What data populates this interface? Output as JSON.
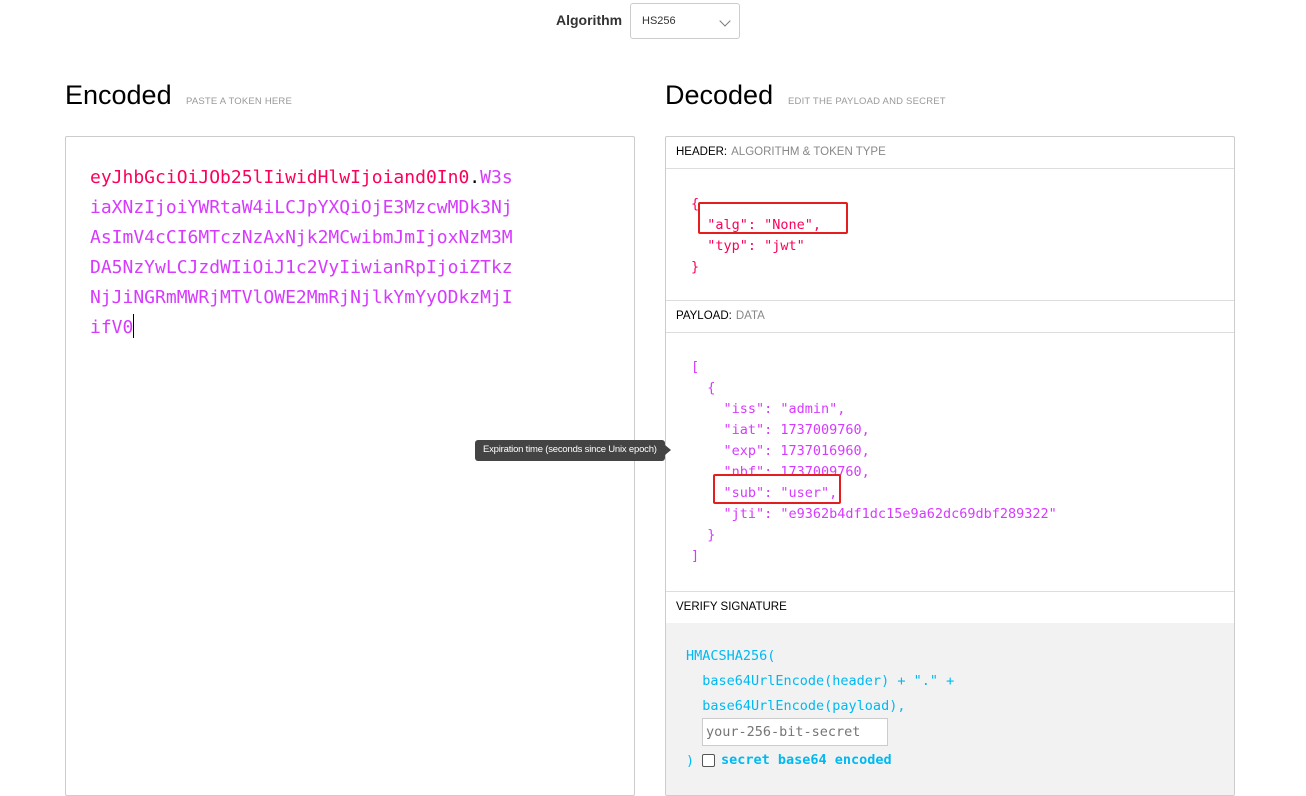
{
  "algorithm": {
    "label": "Algorithm",
    "selected": "HS256"
  },
  "encoded": {
    "title": "Encoded",
    "subtitle": "PASTE A TOKEN HERE",
    "header_part": "eyJhbGciOiJOb25lIiwidHlwIjoiand0In0",
    "dot": ".",
    "payload_lines": [
      "W3s",
      "iaXNzIjoiYWRtaW4iLCJpYXQiOjE3MzcwMDk3Nj",
      "AsImV4cCI6MTczNzAxNjk2MCwibmJmIjoxNzM3M",
      "DA5NzYwLCJzdWIiOiJ1c2VyIiwianRpIjoiZTkz",
      "NjJiNGRmMWRjMTVlOWE2MmRjNjlkYmYyODkzMjI",
      "ifV0"
    ]
  },
  "decoded": {
    "title": "Decoded",
    "subtitle": "EDIT THE PAYLOAD AND SECRET",
    "header_section": {
      "label": "HEADER:",
      "desc": "ALGORITHM & TOKEN TYPE"
    },
    "header_json": [
      "{",
      "  \"alg\": \"None\",",
      "  \"typ\": \"jwt\"",
      "}"
    ],
    "payload_section": {
      "label": "PAYLOAD:",
      "desc": "DATA"
    },
    "payload_json": [
      "[",
      "  {",
      "    \"iss\": \"admin\",",
      "    \"iat\": 1737009760,",
      "    \"exp\": 1737016960,",
      "    \"nbf\": 1737009760,",
      "    \"sub\": \"user\",",
      "    \"jti\": \"e9362b4df1dc15e9a62dc69dbf289322\"",
      "  }",
      "]"
    ],
    "verify_section": {
      "label": "VERIFY SIGNATURE"
    },
    "signature": {
      "line1": "HMACSHA256(",
      "line2": "  base64UrlEncode(header) + \".\" +",
      "line3": "  base64UrlEncode(payload),",
      "secret_placeholder": "your-256-bit-secret",
      "close": ")",
      "checkbox_label": "secret base64 encoded",
      "checkbox_checked": false
    }
  },
  "tooltip": {
    "text": "Expiration time (seconds since Unix epoch)"
  },
  "colors": {
    "header": "#fb015b",
    "payload": "#d63aff",
    "signature": "#00b9f1",
    "annotation": "#e41e1e"
  }
}
